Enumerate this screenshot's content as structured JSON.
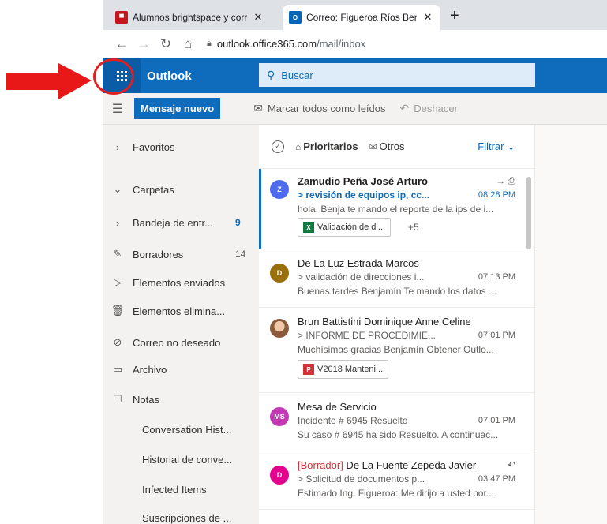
{
  "browser": {
    "tabs": [
      {
        "title": "Alumnos brightspace y correo | ll",
        "favicon": "bright-favicon",
        "active": false
      },
      {
        "title": "Correo: Figueroa Ríos Benjamín -",
        "favicon": "outlook-favicon",
        "active": true
      }
    ],
    "new_tab_label": "+",
    "close_label": "✕",
    "url_host": "outlook.office365.com",
    "url_path": "/mail/inbox"
  },
  "header": {
    "app_name": "Outlook",
    "search_placeholder": "Buscar"
  },
  "commandbar": {
    "new_message": "Mensaje nuevo",
    "mark_all_read": "Marcar todos como leídos",
    "undo": "Deshacer"
  },
  "sidebar": {
    "favorites": "Favoritos",
    "folders": "Carpetas",
    "items": [
      {
        "label": "Bandeja de entr...",
        "count": "9",
        "icon": "chevron-right-icon"
      },
      {
        "label": "Borradores",
        "count": "14",
        "icon": "pencil-icon"
      },
      {
        "label": "Elementos enviados",
        "count": "",
        "icon": "send-icon"
      },
      {
        "label": "Elementos elimina...",
        "count": "",
        "icon": "trash-icon"
      },
      {
        "label": "Correo no deseado",
        "count": "",
        "icon": "block-icon"
      },
      {
        "label": "Archivo",
        "count": "",
        "icon": "archive-icon"
      },
      {
        "label": "Notas",
        "count": "",
        "icon": "note-icon"
      },
      {
        "label": "Conversation Hist...",
        "count": "",
        "icon": ""
      },
      {
        "label": "Historial de conve...",
        "count": "",
        "icon": ""
      },
      {
        "label": "Infected Items",
        "count": "",
        "icon": ""
      },
      {
        "label": "Suscripciones de ...",
        "count": "",
        "icon": ""
      }
    ]
  },
  "list": {
    "pivot_focused": "Prioritarios",
    "pivot_other": "Otros",
    "filter": "Filtrar",
    "messages": [
      {
        "sender": "Zamudio Peña José Arturo",
        "subject": "> revisión de equipos ip, cc...",
        "time": "08:28 PM",
        "preview": "hola, Benja te mando el reporte de la ips de i...",
        "avatar_initial": "Z",
        "avatar_color": "#4f6bed",
        "attachment": "Validación de di...",
        "more": "+5",
        "unread": true
      },
      {
        "sender": "De La Luz Estrada Marcos",
        "subject": "> validación de direcciones i...",
        "time": "07:13 PM",
        "preview": "Buenas tardes Benjamín Te mando los datos ...",
        "avatar_initial": "D",
        "avatar_color": "#986f0b",
        "unread": false
      },
      {
        "sender": "Brun Battistini Dominique Anne Celine",
        "subject": "> INFORME DE PROCEDIMIE...",
        "time": "07:01 PM",
        "preview": "Muchísimas gracias Benjamín Obtener Outlo...",
        "attachment": "V2018 Manteni...",
        "unread": false
      },
      {
        "sender": "Mesa de Servicio",
        "subject": "Incidente # 6945 Resuelto",
        "time": "07:01 PM",
        "preview": "Su caso # 6945 ha sido Resuelto. A continuac...",
        "avatar_initial": "MS",
        "avatar_color": "#c239b3",
        "unread": false
      },
      {
        "draft_tag": "[Borrador]",
        "sender": " De La Fuente Zepeda Javier",
        "subject": "> Solicitud de documentos p...",
        "time": "03:47 PM",
        "preview": "Estimado Ing. Figueroa: Me dirijo a usted por...",
        "avatar_initial": "D",
        "avatar_color": "#e3008c",
        "unread": false
      }
    ]
  },
  "colors": {
    "brand": "#0f6cbd",
    "annotation": "#e02020"
  }
}
